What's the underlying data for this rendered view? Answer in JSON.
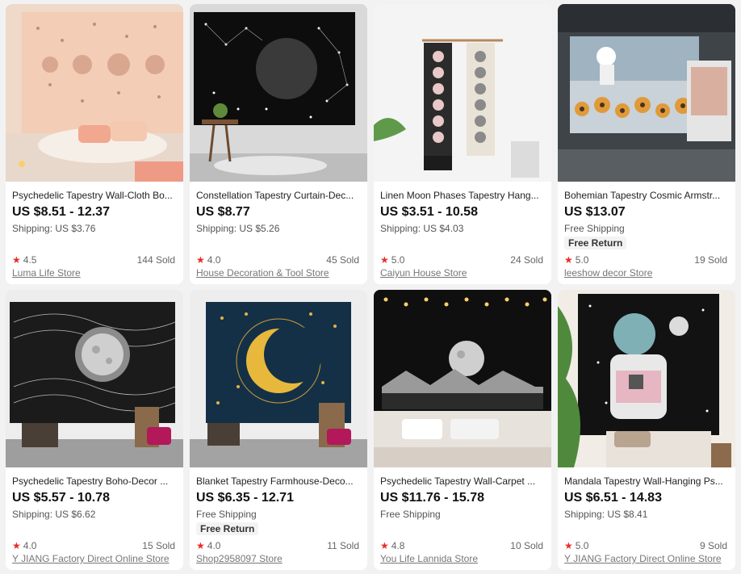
{
  "products": [
    {
      "title": "Psychedelic Tapestry Wall-Cloth Bo...",
      "price": "US $8.51 - 12.37",
      "shipping": "Shipping: US $3.76",
      "badge": "",
      "rating": "4.5",
      "sold": "144 Sold",
      "store": "Luma Life Store"
    },
    {
      "title": "Constellation Tapestry Curtain-Dec...",
      "price": "US $8.77",
      "shipping": "Shipping: US $5.26",
      "badge": "",
      "rating": "4.0",
      "sold": "45 Sold",
      "store": "House Decoration & Tool Store"
    },
    {
      "title": "Linen Moon Phases Tapestry Hang...",
      "price": "US $3.51 - 10.58",
      "shipping": "Shipping: US $4.03",
      "badge": "",
      "rating": "5.0",
      "sold": "24 Sold",
      "store": "Caiyun House Store"
    },
    {
      "title": "Bohemian Tapestry Cosmic Armstr...",
      "price": "US $13.07",
      "shipping": "Free Shipping",
      "badge": "Free Return",
      "rating": "5.0",
      "sold": "19 Sold",
      "store": "leeshow decor Store"
    },
    {
      "title": "Psychedelic Tapestry Boho-Decor ...",
      "price": "US $5.57 - 10.78",
      "shipping": "Shipping: US $6.62",
      "badge": "",
      "rating": "4.0",
      "sold": "15 Sold",
      "store": "Y JIANG Factory Direct Online Store"
    },
    {
      "title": "Blanket Tapestry Farmhouse-Deco...",
      "price": "US $6.35 - 12.71",
      "shipping": "Free Shipping",
      "badge": "Free Return",
      "rating": "4.0",
      "sold": "11 Sold",
      "store": "Shop2958097 Store"
    },
    {
      "title": "Psychedelic Tapestry Wall-Carpet ...",
      "price": "US $11.76 - 15.78",
      "shipping": "Free Shipping",
      "badge": "",
      "rating": "4.8",
      "sold": "10 Sold",
      "store": "You Life Lannida Store"
    },
    {
      "title": "Mandala Tapestry Wall-Hanging Ps...",
      "price": "US $6.51 - 14.83",
      "shipping": "Shipping: US $8.41",
      "badge": "",
      "rating": "5.0",
      "sold": "9 Sold",
      "store": "Y JIANG Factory Direct Online Store"
    }
  ],
  "colors": {
    "star": "#e62e24",
    "price": "#111111",
    "background": "#f2f2f2"
  },
  "icons": {
    "rating": "star-icon"
  }
}
